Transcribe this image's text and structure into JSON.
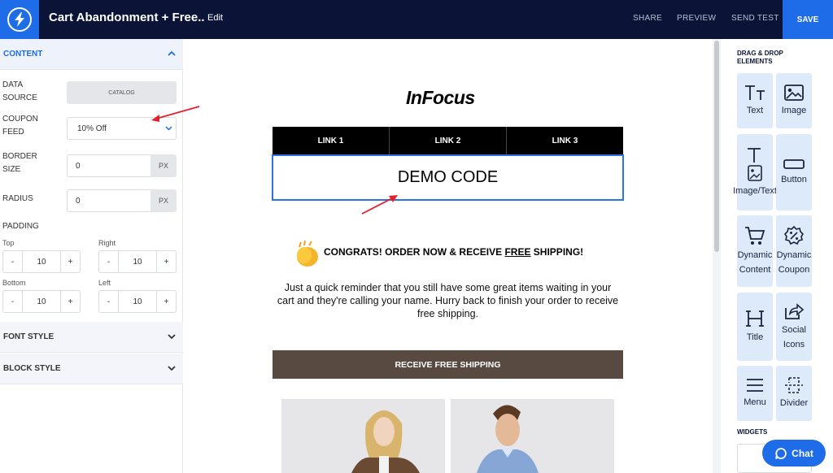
{
  "header": {
    "title": "Cart Abandonment + Free..",
    "edit_label": "Edit",
    "share_label": "SHARE",
    "preview_label": "PREVIEW",
    "send_test_label": "SEND TEST",
    "save_label": "SAVE"
  },
  "left_panel": {
    "content_section": "CONTENT",
    "data_source": {
      "label_line1": "DATA",
      "label_line2": "SOURCE",
      "button": "CATALOG"
    },
    "coupon_feed": {
      "label_line1": "COUPON",
      "label_line2": "FEED",
      "value": "10% Off"
    },
    "border_size": {
      "label_line1": "BORDER",
      "label_line2": "SIZE",
      "value": "0",
      "unit": "PX"
    },
    "radius": {
      "label": "RADIUS",
      "value": "0",
      "unit": "PX"
    },
    "padding": {
      "label": "PADDING",
      "top": {
        "label": "Top",
        "value": "10"
      },
      "right": {
        "label": "Right",
        "value": "10"
      },
      "bottom": {
        "label": "Bottom",
        "value": "10"
      },
      "left": {
        "label": "Left",
        "value": "10"
      },
      "minus": "-",
      "plus": "+"
    },
    "font_style_section": "FONT STYLE",
    "block_style_section": "BLOCK STYLE"
  },
  "email": {
    "brand": "InFocus",
    "nav_links": [
      "LINK 1",
      "LINK 2",
      "LINK 3"
    ],
    "coupon_code": "DEMO CODE",
    "headline_pre": "CONGRATS! ORDER NOW & RECEIVE ",
    "headline_underlined": "FREE",
    "headline_post": " SHIPPING!",
    "body": "Just a quick reminder that you still have some great items waiting in your cart and they're calling your name. Hurry back to finish your order to receive free shipping.",
    "cta": "RECEIVE FREE SHIPPING"
  },
  "right_panel": {
    "heading_line1": "DRAG & DROP",
    "heading_line2": "ELEMENTS",
    "tiles": [
      {
        "label": "Text",
        "icon": "text-icon"
      },
      {
        "label": "Image",
        "icon": "image-icon"
      },
      {
        "label": "Image/Text",
        "icon": "image-text-icon"
      },
      {
        "label": "Button",
        "icon": "button-icon"
      },
      {
        "label_line1": "Dynamic",
        "label_line2": "Content",
        "icon": "cart-icon"
      },
      {
        "label_line1": "Dynamic",
        "label_line2": "Coupon",
        "icon": "coupon-icon"
      },
      {
        "label": "Title",
        "icon": "heading-icon"
      },
      {
        "label_line1": "Social",
        "label_line2": "Icons",
        "icon": "share-icon"
      },
      {
        "label": "Menu",
        "icon": "menu-icon"
      },
      {
        "label": "Divider",
        "icon": "divider-icon"
      }
    ],
    "widgets_heading": "WIDGETS",
    "chat_label": "Chat"
  },
  "colors": {
    "topbar": "#0b1437",
    "accent": "#1f6ce8",
    "tile_bg": "#dceaf9",
    "cta_bg": "#584a41",
    "annotation_arrow": "#e5202a"
  }
}
